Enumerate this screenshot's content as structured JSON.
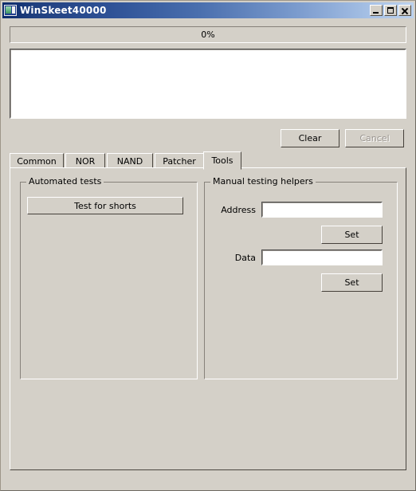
{
  "window": {
    "title": "WinSkeet40000",
    "icon": "application-window-icon",
    "controls": {
      "minimize": "Minimize",
      "maximize": "Maximize",
      "close": "Close"
    }
  },
  "progress": {
    "label": "0%",
    "value": 0
  },
  "log": {
    "text": "",
    "placeholder": ""
  },
  "actions": {
    "clear_label": "Clear",
    "cancel_label": "Cancel",
    "cancel_enabled": false
  },
  "tabs": {
    "items": [
      {
        "label": "Common",
        "active": false
      },
      {
        "label": "NOR",
        "active": false
      },
      {
        "label": "NAND",
        "active": false
      },
      {
        "label": "Patcher",
        "active": false
      },
      {
        "label": "Tools",
        "active": true
      }
    ],
    "selected": "Tools"
  },
  "tools_page": {
    "automated_tests": {
      "title": "Automated tests",
      "test_for_shorts_label": "Test for shorts"
    },
    "manual_testing_helpers": {
      "title": "Manual testing helpers",
      "address_label": "Address",
      "address_value": "",
      "address_placeholder": "",
      "address_set_label": "Set",
      "data_label": "Data",
      "data_value": "",
      "data_placeholder": "",
      "data_set_label": "Set"
    }
  },
  "colors": {
    "face": "#d4d0c8",
    "title_start": "#0b2a6b",
    "title_end": "#bcd2ee",
    "text": "#000000",
    "disabled_text": "#9b9691",
    "field_bg": "#ffffff"
  }
}
